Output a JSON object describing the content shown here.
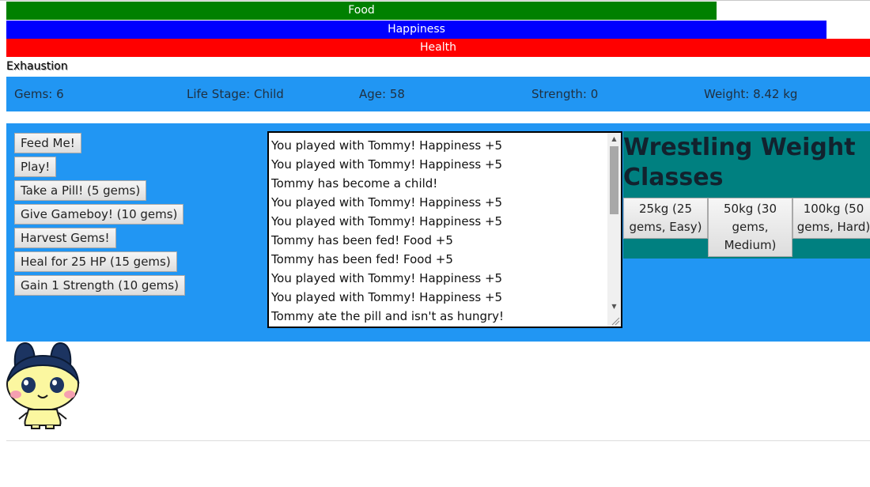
{
  "bars": {
    "food": {
      "label": "Food",
      "level": 0.822
    },
    "happiness": {
      "label": "Happiness",
      "level": 0.95
    },
    "health": {
      "label": "Health",
      "level": 1.0
    }
  },
  "exhaustion_label": "Exhaustion",
  "stats": {
    "gems": "Gems: 6",
    "life_stage": "Life Stage: Child",
    "age": "Age: 58",
    "strength": "Strength: 0",
    "weight": "Weight: 8.42 kg"
  },
  "actions": [
    "Feed Me!",
    "Play!",
    "Take a Pill! (5 gems)",
    "Give Gameboy! (10 gems)",
    "Harvest Gems!",
    "Heal for 25 HP (15 gems)",
    "Gain 1 Strength (10 gems)"
  ],
  "log": [
    "You played with Tommy! Happiness +5",
    "You played with Tommy! Happiness +5",
    "Tommy has become a child!",
    "You played with Tommy! Happiness +5",
    "You played with Tommy! Happiness +5",
    "Tommy has been fed! Food +5",
    "Tommy has been fed! Food +5",
    "You played with Tommy! Happiness +5",
    "You played with Tommy! Happiness +5",
    "Tommy ate the pill and isn't as hungry!"
  ],
  "wrestling": {
    "title": "Wrestling Weight Classes",
    "classes": [
      "25kg (25 gems, Easy)",
      "50kg (30 gems, Medium)",
      "100kg (50 gems, Hard)"
    ]
  },
  "colors": {
    "food": "#008000",
    "happiness": "#0000ff",
    "health": "#ff0000",
    "panel": "#2196f3",
    "wrestle": "#008080"
  },
  "icons": {
    "pet": "pet-character-icon"
  }
}
